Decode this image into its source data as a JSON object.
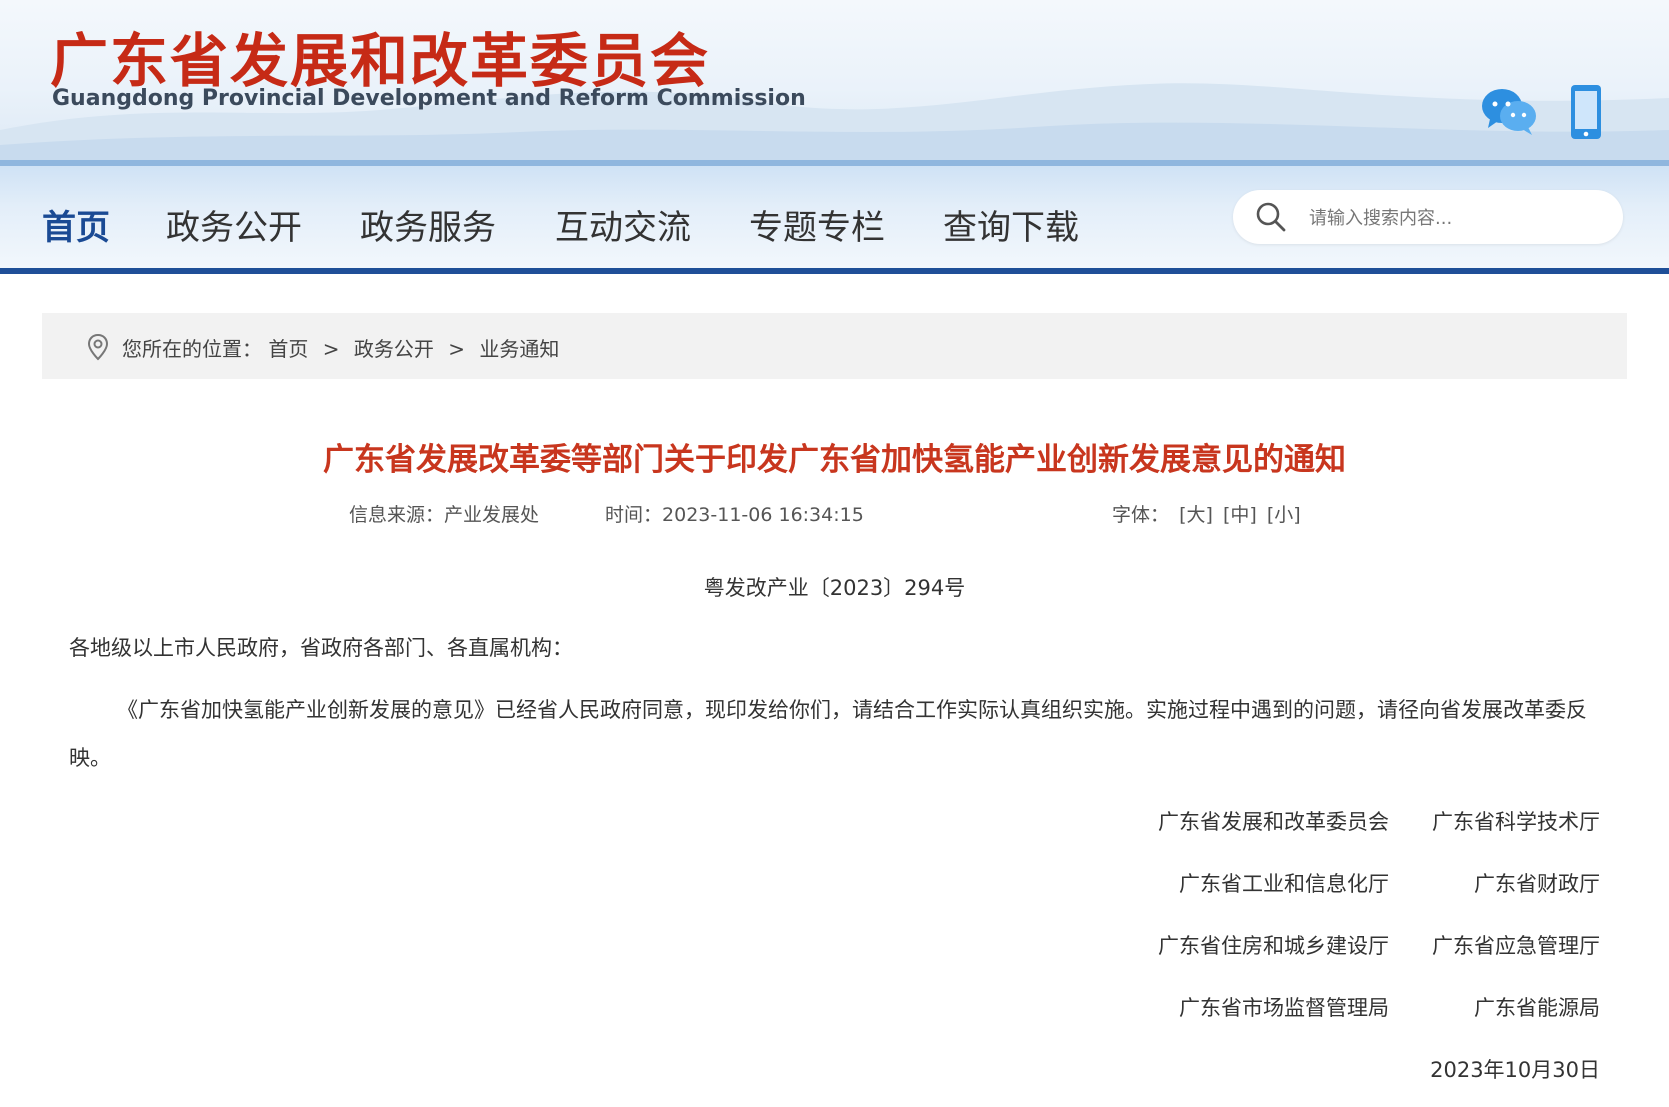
{
  "header": {
    "logo_cn": "广东省发展和改革委员会",
    "logo_en": "Guangdong Provincial Development and Reform Commission",
    "icons": [
      "wechat-icon",
      "mobile-icon"
    ]
  },
  "nav": {
    "items": [
      {
        "label": "首页",
        "active": true
      },
      {
        "label": "政务公开",
        "active": false
      },
      {
        "label": "政务服务",
        "active": false
      },
      {
        "label": "互动交流",
        "active": false
      },
      {
        "label": "专题专栏",
        "active": false
      },
      {
        "label": "查询下载",
        "active": false
      }
    ],
    "search_placeholder": "请输入搜索内容..."
  },
  "breadcrumb": {
    "prefix": "您所在的位置：",
    "items": [
      "首页",
      "政务公开",
      "业务通知"
    ],
    "separator": ">"
  },
  "article": {
    "title": "广东省发展改革委等部门关于印发广东省加快氢能产业创新发展意见的通知",
    "source_label": "信息来源：",
    "source": "产业发展处",
    "time_label": "时间：",
    "time": "2023-11-06 16:34:15",
    "font_label": "字体：",
    "font_large": "[大]",
    "font_medium": "[中]",
    "font_small": "[小]",
    "doc_number": "粤发改产业〔2023〕294号",
    "salutation": "各地级以上市人民政府，省政府各部门、各直属机构：",
    "body": "《广东省加快氢能产业创新发展的意见》已经省人民政府同意，现印发给你们，请结合工作实际认真组织实施。实施过程中遇到的问题，请径向省发展改革委反映。",
    "signers": [
      [
        "广东省发展和改革委员会",
        "广东省科学技术厅"
      ],
      [
        "广东省工业和信息化厅",
        "广东省财政厅"
      ],
      [
        "广东省住房和城乡建设厅",
        "广东省应急管理厅"
      ],
      [
        "广东省市场监督管理局",
        "广东省能源局"
      ]
    ],
    "date": "2023年10月30日"
  },
  "colors": {
    "logo_red": "#c62a16",
    "title_red": "#c8361e",
    "nav_active": "#1a4a94",
    "nav_bottom_bar": "#1f4f98"
  }
}
